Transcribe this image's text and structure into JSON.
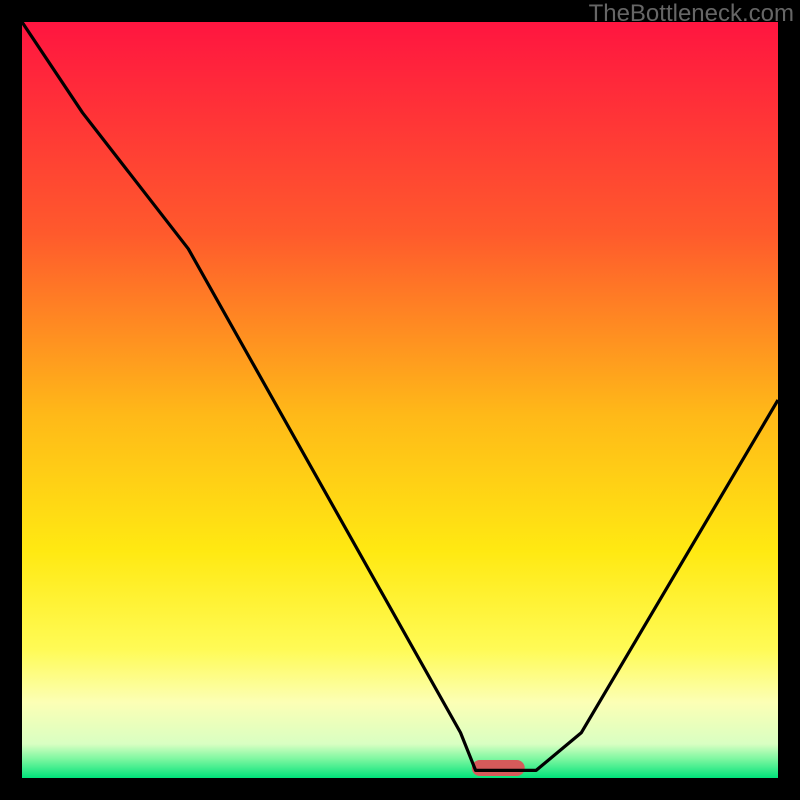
{
  "watermark": "TheBottleneck.com",
  "chart_data": {
    "type": "line",
    "title": "",
    "xlabel": "",
    "ylabel": "",
    "xlim": [
      0,
      100
    ],
    "ylim": [
      0,
      100
    ],
    "x": [
      0,
      8,
      22,
      58,
      60,
      66,
      68,
      74,
      100
    ],
    "values": [
      100,
      88,
      70,
      6,
      1,
      1,
      1,
      6,
      50
    ],
    "optimal_marker": {
      "x": 63,
      "width": 7
    },
    "gradient_stops": [
      {
        "pos": 0.0,
        "color": "#ff1540"
      },
      {
        "pos": 0.28,
        "color": "#ff5a2c"
      },
      {
        "pos": 0.52,
        "color": "#ffb918"
      },
      {
        "pos": 0.7,
        "color": "#ffe912"
      },
      {
        "pos": 0.83,
        "color": "#fffb56"
      },
      {
        "pos": 0.9,
        "color": "#fcffb5"
      },
      {
        "pos": 0.955,
        "color": "#d9ffc2"
      },
      {
        "pos": 0.975,
        "color": "#7cf7a0"
      },
      {
        "pos": 1.0,
        "color": "#00e27a"
      }
    ]
  }
}
